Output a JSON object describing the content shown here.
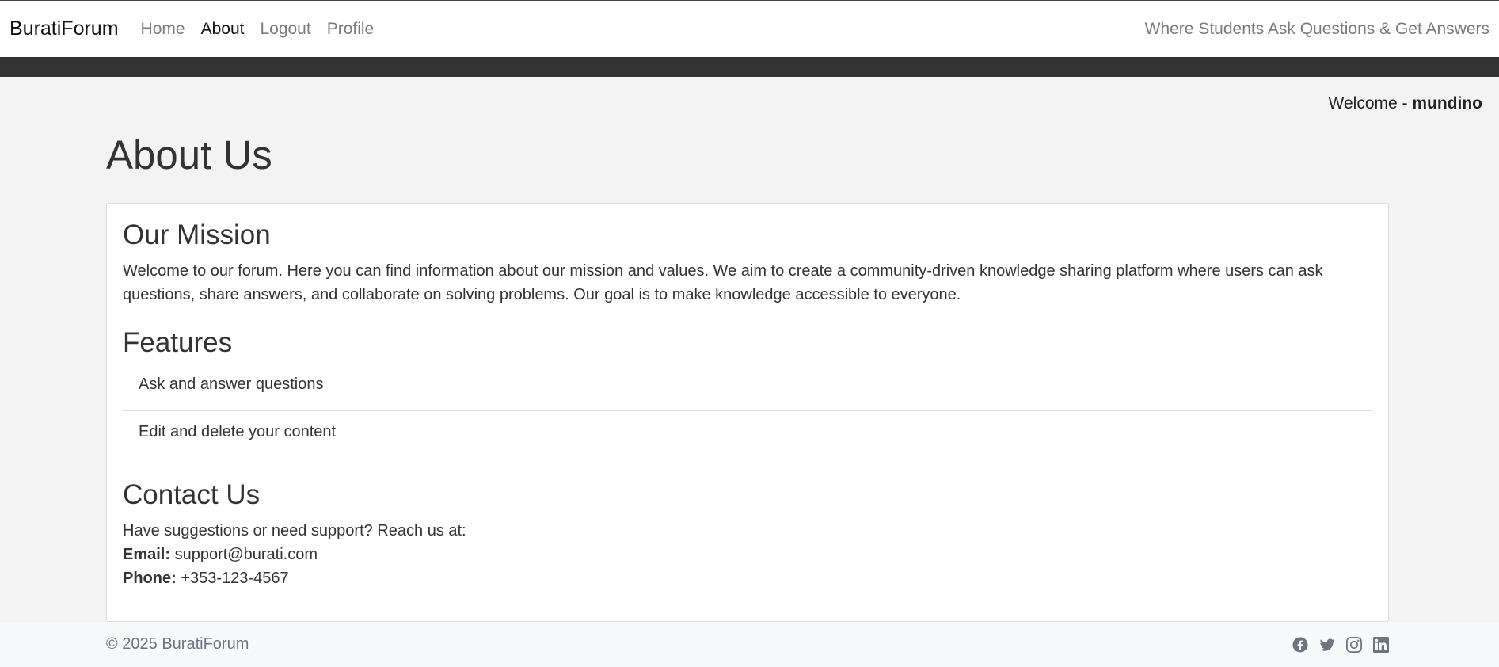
{
  "nav": {
    "brand": "BuratiForum",
    "links": [
      "Home",
      "About",
      "Logout",
      "Profile"
    ],
    "tagline": "Where Students Ask Questions & Get Answers"
  },
  "welcome": {
    "prefix": "Welcome - ",
    "username": "mundino"
  },
  "page_title": "About Us",
  "mission": {
    "heading": "Our Mission",
    "text": "Welcome to our forum. Here you can find information about our mission and values. We aim to create a community-driven knowledge sharing platform where users can ask questions, share answers, and collaborate on solving problems. Our goal is to make knowledge accessible to everyone."
  },
  "features": {
    "heading": "Features",
    "items": [
      "Ask and answer questions",
      "Edit and delete your content"
    ]
  },
  "contact": {
    "heading": "Contact Us",
    "intro": "Have suggestions or need support? Reach us at:",
    "email_label": "Email:",
    "email": "support@burati.com",
    "phone_label": "Phone:",
    "phone": "+353-123-4567"
  },
  "footer": {
    "copyright": "© 2025 BuratiForum",
    "social_icons": [
      "facebook-icon",
      "twitter-icon",
      "instagram-icon",
      "linkedin-icon"
    ]
  }
}
